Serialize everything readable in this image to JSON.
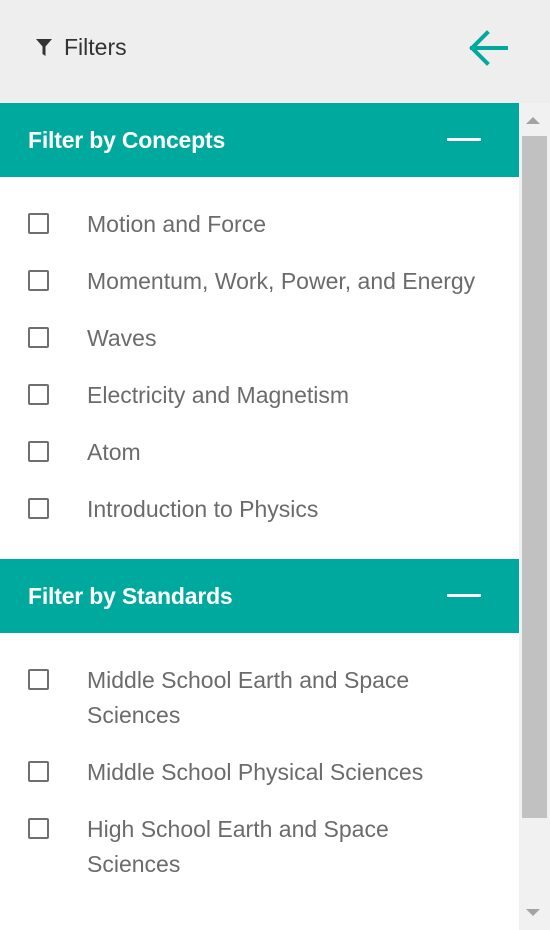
{
  "header": {
    "title": "Filters",
    "filter_icon": "funnel-icon",
    "back_icon": "arrow-left-icon"
  },
  "sections": [
    {
      "title": "Filter by Concepts",
      "collapse_icon": "minus-icon",
      "items": [
        "Motion and Force",
        "Momentum, Work, Power, and Energy",
        "Waves",
        "Electricity and Magnetism",
        "Atom",
        "Introduction to Physics"
      ]
    },
    {
      "title": "Filter by Standards",
      "collapse_icon": "minus-icon",
      "items": [
        "Middle School Earth and Space Sciences",
        "Middle School Physical Sciences",
        "High School Earth and Space Sciences"
      ]
    }
  ],
  "colors": {
    "accent": "#00a99d",
    "header_bg": "#eeeeee",
    "text": "#6b6b6b"
  }
}
